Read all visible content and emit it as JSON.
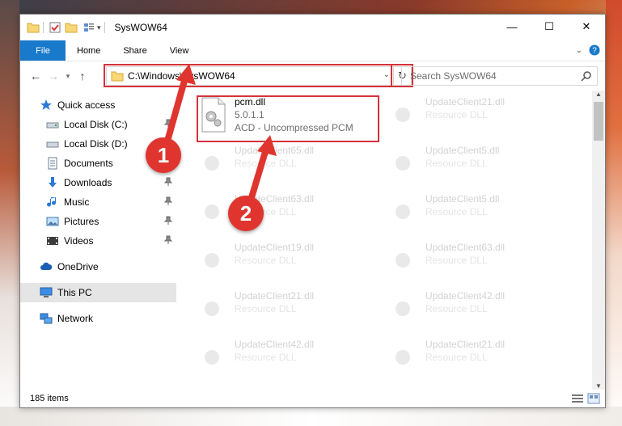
{
  "window": {
    "title": "SysWOW64"
  },
  "ribbon": {
    "tabs": [
      "File",
      "Home",
      "Share",
      "View"
    ]
  },
  "address": {
    "path": "C:\\Windows\\SysWOW64"
  },
  "search": {
    "placeholder": "Search SysWOW64"
  },
  "sidebar": {
    "items": [
      {
        "label": "Quick access",
        "icon": "star-icon"
      },
      {
        "label": "Local Disk (C:)",
        "icon": "drive-icon"
      },
      {
        "label": "Local Disk (D:)",
        "icon": "drive-icon"
      },
      {
        "label": "Documents",
        "icon": "documents-icon"
      },
      {
        "label": "Downloads",
        "icon": "download-icon"
      },
      {
        "label": "Music",
        "icon": "music-icon"
      },
      {
        "label": "Pictures",
        "icon": "pictures-icon"
      },
      {
        "label": "Videos",
        "icon": "videos-icon"
      },
      {
        "label": "OneDrive",
        "icon": "cloud-icon"
      },
      {
        "label": "This PC",
        "icon": "computer-icon"
      },
      {
        "label": "Network",
        "icon": "network-icon"
      }
    ]
  },
  "files": {
    "highlighted": {
      "name": "pcm.dll",
      "version": "5.0.1.1",
      "description": "ACD - Uncompressed PCM"
    },
    "faded": [
      {
        "name": "UpdateClient21.dll",
        "desc": "Resource DLL"
      },
      {
        "name": "UpdateClient65.dll",
        "desc": "Resource DLL"
      },
      {
        "name": "UpdateClient5.dll",
        "desc": "Resource DLL"
      },
      {
        "name": "UpdateClient63.dll",
        "desc": "Resource DLL"
      },
      {
        "name": "UpdateClient5.dll",
        "desc": "Resource DLL"
      },
      {
        "name": "UpdateClient19.dll",
        "desc": "Resource DLL"
      },
      {
        "name": "UpdateClient63.dll",
        "desc": "Resource DLL"
      },
      {
        "name": "UpdateClient21.dll",
        "desc": "Resource DLL"
      },
      {
        "name": "UpdateClient42.dll",
        "desc": "Resource DLL"
      },
      {
        "name": "UpdateClient42.dll",
        "desc": "Resource DLL"
      },
      {
        "name": "UpdateClient21.dll",
        "desc": "Resource DLL"
      }
    ]
  },
  "status": {
    "count": "185 items"
  },
  "annotations": {
    "badge1": "1",
    "badge2": "2"
  },
  "colors": {
    "accent": "#1979ca",
    "highlight": "#d6323a",
    "badge": "#e0352f"
  }
}
